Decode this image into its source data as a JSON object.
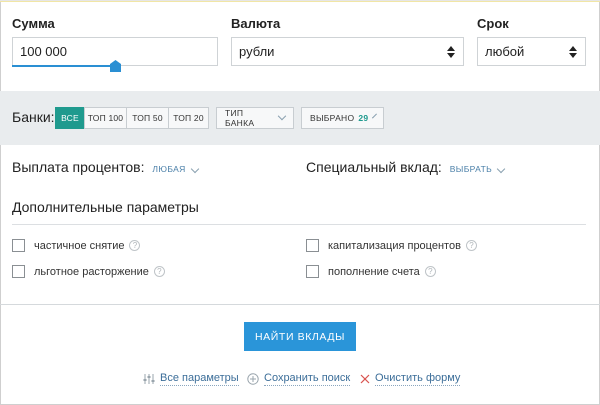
{
  "form": {
    "amount": {
      "label": "Сумма",
      "value": "100 000",
      "slider_fraction": 0.5
    },
    "currency": {
      "label": "Валюта",
      "value": "рубли"
    },
    "term": {
      "label": "Срок",
      "value": "любой"
    }
  },
  "banks": {
    "label": "Банки:",
    "segments": [
      "все",
      "топ 100",
      "топ 50",
      "топ 20"
    ],
    "active_segment": "все",
    "bank_type": "ТИП БАНКА",
    "selected_label": "ВЫБРАНО",
    "selected_count": "29"
  },
  "params": {
    "interest_payout": {
      "label": "Выплата процентов:",
      "value": "любая"
    },
    "special_deposit": {
      "label": "Специальный вклад:",
      "value": "выбрать"
    },
    "additional_heading": "Дополнительные параметры",
    "checkboxes": [
      "частичное снятие",
      "льготное расторжение",
      "капитализация процентов",
      "пополнение счета"
    ],
    "help_glyph": "?"
  },
  "actions": {
    "find": "НАЙТИ ВКЛАДЫ",
    "all_params": "Все параметры",
    "save_search": "Сохранить поиск",
    "clear_form": "Очистить форму"
  },
  "colors": {
    "accent_blue": "#2a95d9",
    "active_green": "#1f9a8e",
    "clear_red": "#d9534f",
    "band_gray": "#e9ecee"
  },
  "icons": [
    "chevron-down-icon",
    "question-icon",
    "sliders-icon",
    "plus-circle-icon",
    "close-icon",
    "up-down-arrows-icon"
  ]
}
